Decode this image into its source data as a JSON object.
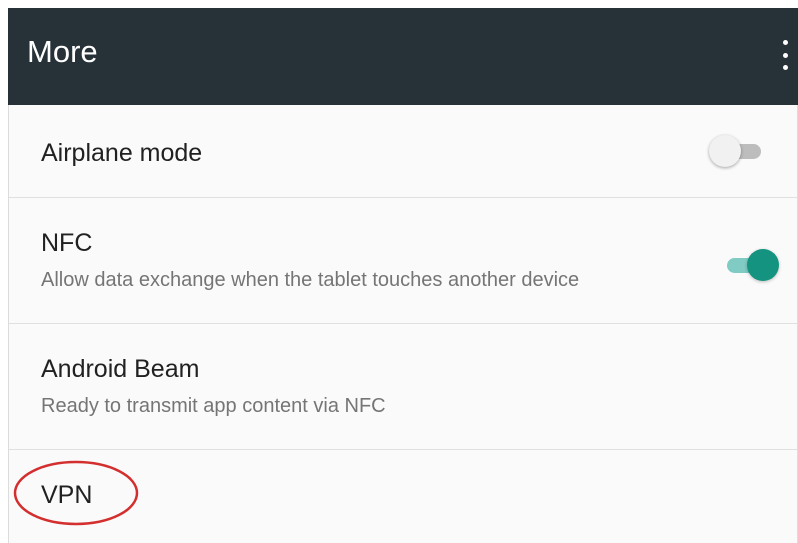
{
  "appbar": {
    "title": "More",
    "menu_icon": "more-vert-icon",
    "background_color": "#263238"
  },
  "settings": {
    "airplane": {
      "title": "Airplane mode",
      "toggle_state": "off"
    },
    "nfc": {
      "title": "NFC",
      "summary": "Allow data exchange when the tablet touches another device",
      "toggle_state": "on",
      "toggle_color": "#139380"
    },
    "android_beam": {
      "title": "Android Beam",
      "summary": "Ready to transmit app content via NFC"
    },
    "vpn": {
      "title": "VPN",
      "highlight": "red-circle",
      "highlight_color": "#d32f2f"
    }
  }
}
